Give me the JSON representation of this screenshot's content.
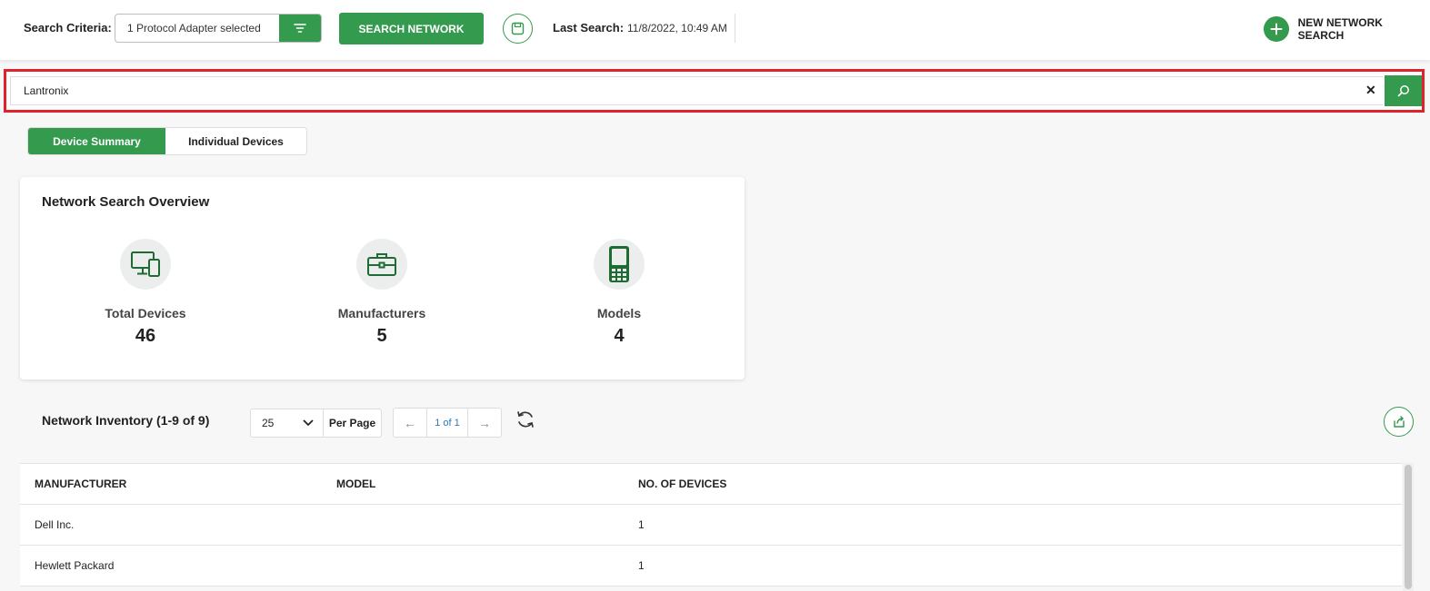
{
  "header": {
    "search_criteria_label": "Search Criteria:",
    "search_criteria_value": "1 Protocol Adapter selected",
    "search_network_label": "SEARCH NETWORK",
    "last_search_label": "Last Search:",
    "last_search_value": "11/8/2022, 10:49 AM",
    "new_search_label": "NEW NETWORK SEARCH"
  },
  "search": {
    "value": "Lantronix",
    "clear_glyph": "✕"
  },
  "tabs": [
    {
      "label": "Device Summary",
      "active": true
    },
    {
      "label": "Individual Devices",
      "active": false
    }
  ],
  "overview": {
    "title": "Network Search Overview",
    "stats": [
      {
        "label": "Total Devices",
        "value": "46",
        "icon": "devices-icon"
      },
      {
        "label": "Manufacturers",
        "value": "5",
        "icon": "briefcase-icon"
      },
      {
        "label": "Models",
        "value": "4",
        "icon": "handheld-device-icon"
      }
    ]
  },
  "inventory": {
    "title": "Network Inventory (1-9 of 9)",
    "per_page_value": "25",
    "per_page_label": "Per Page",
    "page_indicator": "1 of 1",
    "prev_glyph": "←",
    "next_glyph": "→",
    "columns": [
      "MANUFACTURER",
      "MODEL",
      "NO. OF DEVICES"
    ],
    "rows": [
      {
        "manufacturer": "Dell Inc.",
        "model": "",
        "count": "1"
      },
      {
        "manufacturer": "Hewlett Packard",
        "model": "",
        "count": "1"
      }
    ]
  },
  "colors": {
    "accent": "#339a4e",
    "highlight_border": "#e0222a",
    "link": "#2a7ab8"
  }
}
